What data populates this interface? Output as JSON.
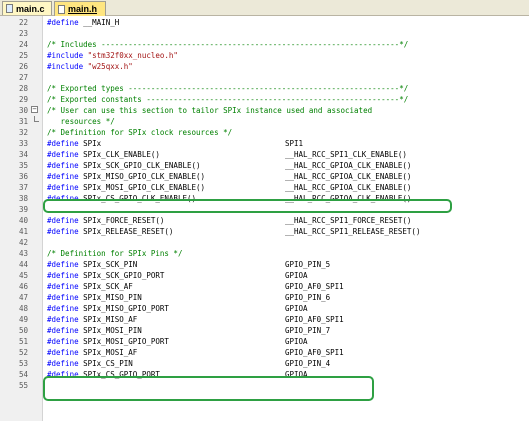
{
  "tabs": [
    {
      "label": "main.c",
      "active": false
    },
    {
      "label": "main.h",
      "active": true
    }
  ],
  "lines": [
    {
      "num": "22",
      "directive": "#define",
      "code": " __MAIN_H"
    },
    {
      "num": "23"
    },
    {
      "num": "24",
      "comment": "/* Includes ------------------------------------------------------------------*/"
    },
    {
      "num": "25",
      "directive": "#include",
      "string": " \"stm32f0xx_nucleo.h\""
    },
    {
      "num": "26",
      "directive": "#include",
      "string": " \"w25qxx.h\""
    },
    {
      "num": "27"
    },
    {
      "num": "28",
      "comment": "/* Exported types ------------------------------------------------------------*/"
    },
    {
      "num": "29",
      "comment": "/* Exported constants --------------------------------------------------------*/"
    },
    {
      "num": "30",
      "comment": "/* User can use this section to tailor SPIx instance used and associated",
      "fold": "start"
    },
    {
      "num": "31",
      "comment": "   resources */",
      "fold": "end"
    },
    {
      "num": "32",
      "comment": "/* Definition for SPIx clock resources */"
    },
    {
      "num": "33",
      "directive": "#define",
      "code": " SPIx",
      "value": "SPI1"
    },
    {
      "num": "34",
      "directive": "#define",
      "code": " SPIx_CLK_ENABLE()",
      "value": "__HAL_RCC_SPI1_CLK_ENABLE()"
    },
    {
      "num": "35",
      "directive": "#define",
      "code": " SPIx_SCK_GPIO_CLK_ENABLE()",
      "value": "__HAL_RCC_GPIOA_CLK_ENABLE()"
    },
    {
      "num": "36",
      "directive": "#define",
      "code": " SPIx_MISO_GPIO_CLK_ENABLE()",
      "value": "__HAL_RCC_GPIOA_CLK_ENABLE()"
    },
    {
      "num": "37",
      "directive": "#define",
      "code": " SPIx_MOSI_GPIO_CLK_ENABLE()",
      "value": "__HAL_RCC_GPIOA_CLK_ENABLE()"
    },
    {
      "num": "38",
      "directive": "#define",
      "code": " SPIx_CS_GPIO_CLK_ENABLE()",
      "value": "__HAL_RCC_GPIOA_CLK_ENABLE()"
    },
    {
      "num": "39"
    },
    {
      "num": "40",
      "directive": "#define",
      "code": " SPIx_FORCE_RESET()",
      "value": "__HAL_RCC_SPI1_FORCE_RESET()"
    },
    {
      "num": "41",
      "directive": "#define",
      "code": " SPIx_RELEASE_RESET()",
      "value": "__HAL_RCC_SPI1_RELEASE_RESET()"
    },
    {
      "num": "42"
    },
    {
      "num": "43",
      "comment": "/* Definition for SPIx Pins */"
    },
    {
      "num": "44",
      "directive": "#define",
      "code": " SPIx_SCK_PIN",
      "value": "GPIO_PIN_5"
    },
    {
      "num": "45",
      "directive": "#define",
      "code": " SPIx_SCK_GPIO_PORT",
      "value": "GPIOA"
    },
    {
      "num": "46",
      "directive": "#define",
      "code": " SPIx_SCK_AF",
      "value": "GPIO_AF0_SPI1"
    },
    {
      "num": "47",
      "directive": "#define",
      "code": " SPIx_MISO_PIN",
      "value": "GPIO_PIN_6"
    },
    {
      "num": "48",
      "directive": "#define",
      "code": " SPIx_MISO_GPIO_PORT",
      "value": "GPIOA"
    },
    {
      "num": "49",
      "directive": "#define",
      "code": " SPIx_MISO_AF",
      "value": "GPIO_AF0_SPI1"
    },
    {
      "num": "50",
      "directive": "#define",
      "code": " SPIx_MOSI_PIN",
      "value": "GPIO_PIN_7"
    },
    {
      "num": "51",
      "directive": "#define",
      "code": " SPIx_MOSI_GPIO_PORT",
      "value": "GPIOA"
    },
    {
      "num": "52",
      "directive": "#define",
      "code": " SPIx_MOSI_AF",
      "value": "GPIO_AF0_SPI1"
    },
    {
      "num": "53",
      "directive": "#define",
      "code": " SPIx_CS_PIN",
      "value": "GPIO_PIN_4"
    },
    {
      "num": "54",
      "directive": "#define",
      "code": " SPIx_CS_GPIO_PORT",
      "value": "GPIOA"
    },
    {
      "num": "55"
    }
  ],
  "highlight_color": "#2ea043",
  "colors": {
    "directive": "#0000ff",
    "comment": "#008000",
    "string": "#a31515"
  }
}
